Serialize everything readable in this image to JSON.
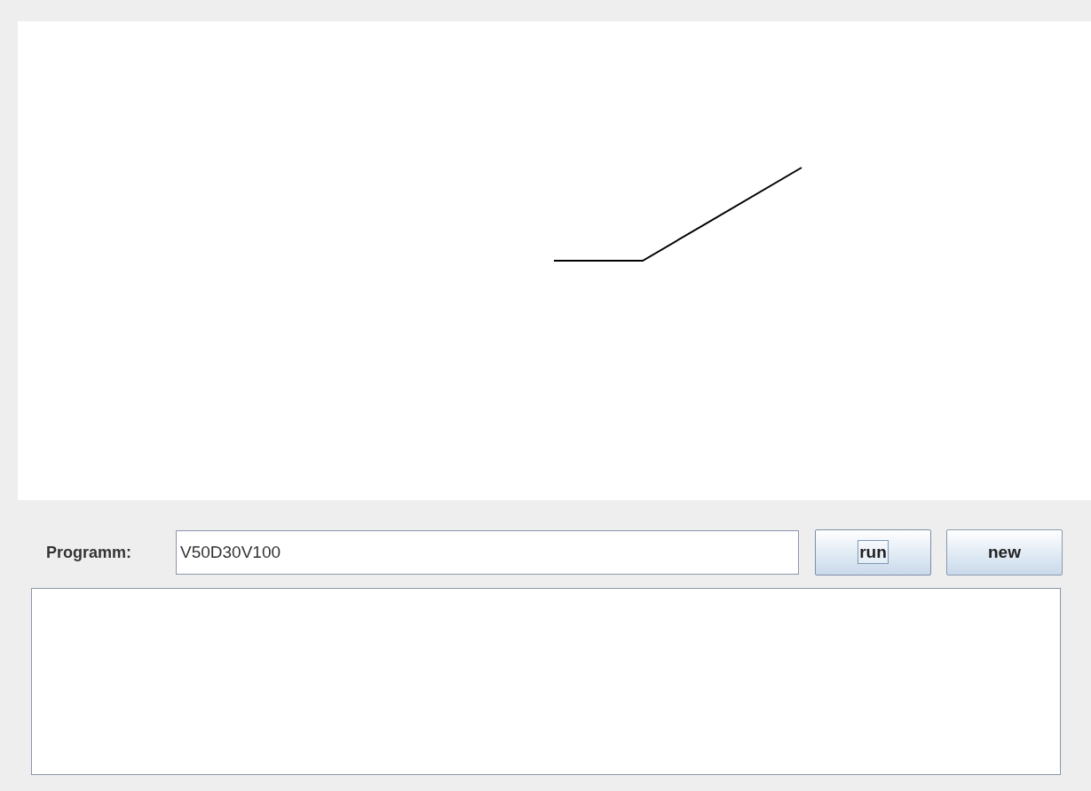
{
  "program": {
    "label": "Programm:",
    "value": "V50D30V100"
  },
  "buttons": [
    {
      "label": "run",
      "focused": true
    },
    {
      "label": "new",
      "focused": false
    }
  ]
}
